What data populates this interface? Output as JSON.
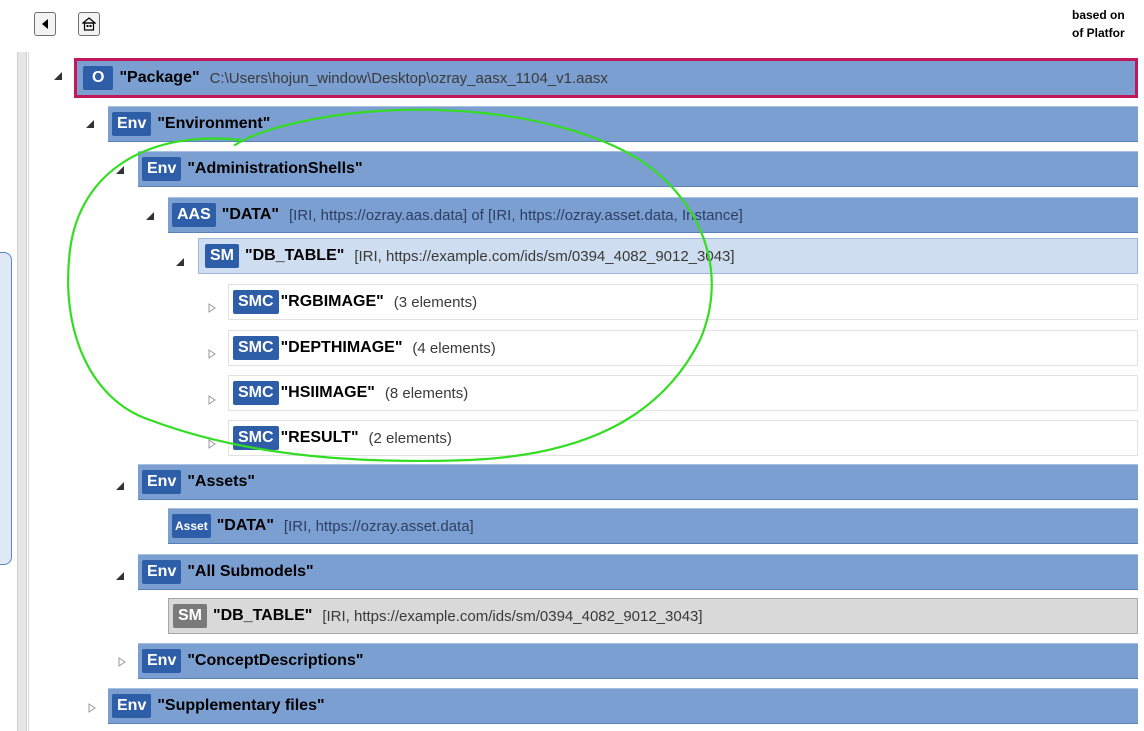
{
  "toolbar": {
    "hint_line1": "based on",
    "hint_line2": "of Platfor"
  },
  "tree": {
    "package": {
      "tag": "O",
      "name": "\"Package\"",
      "info": "C:\\Users\\hojun_window\\Desktop\\ozray_aasx_1104_v1.aasx"
    },
    "environment": {
      "tag": "Env",
      "name": "\"Environment\""
    },
    "admin_shells": {
      "tag": "Env",
      "name": "\"AdministrationShells\""
    },
    "aas": {
      "tag": "AAS",
      "name": "\"DATA\"",
      "info": "[IRI, https://ozray.aas.data] of [IRI, https://ozray.asset.data, Instance]"
    },
    "submodel": {
      "tag": "SM",
      "name": "\"DB_TABLE\"",
      "info": "[IRI, https://example.com/ids/sm/0394_4082_9012_3043]"
    },
    "collections": [
      {
        "tag": "SMC",
        "name": "\"RGBIMAGE\"",
        "info": "(3 elements)"
      },
      {
        "tag": "SMC",
        "name": "\"DEPTHIMAGE\"",
        "info": "(4 elements)"
      },
      {
        "tag": "SMC",
        "name": "\"HSIIMAGE\"",
        "info": "(8 elements)"
      },
      {
        "tag": "SMC",
        "name": "\"RESULT\"",
        "info": "(2 elements)"
      }
    ],
    "assets": {
      "tag": "Env",
      "name": "\"Assets\""
    },
    "asset": {
      "tag": "Asset",
      "name": "\"DATA\"",
      "info": "[IRI, https://ozray.asset.data]"
    },
    "all_submodels": {
      "tag": "Env",
      "name": "\"All Submodels\""
    },
    "all_sm": {
      "tag": "SM",
      "name": "\"DB_TABLE\"",
      "info": "[IRI, https://example.com/ids/sm/0394_4082_9012_3043]"
    },
    "concept_desc": {
      "tag": "Env",
      "name": "\"ConceptDescriptions\""
    },
    "supp_files": {
      "tag": "Env",
      "name": "\"Supplementary files\""
    }
  },
  "icons": {
    "back": "back-arrow-icon",
    "home": "home-icon",
    "expanded": "triangle-down-icon",
    "collapsed": "triangle-right-icon"
  },
  "colors": {
    "row_blue": "#7b9fd0",
    "tag_blue": "#2f5ea8",
    "selection": "#c2185b",
    "annotation": "#33dd22"
  }
}
